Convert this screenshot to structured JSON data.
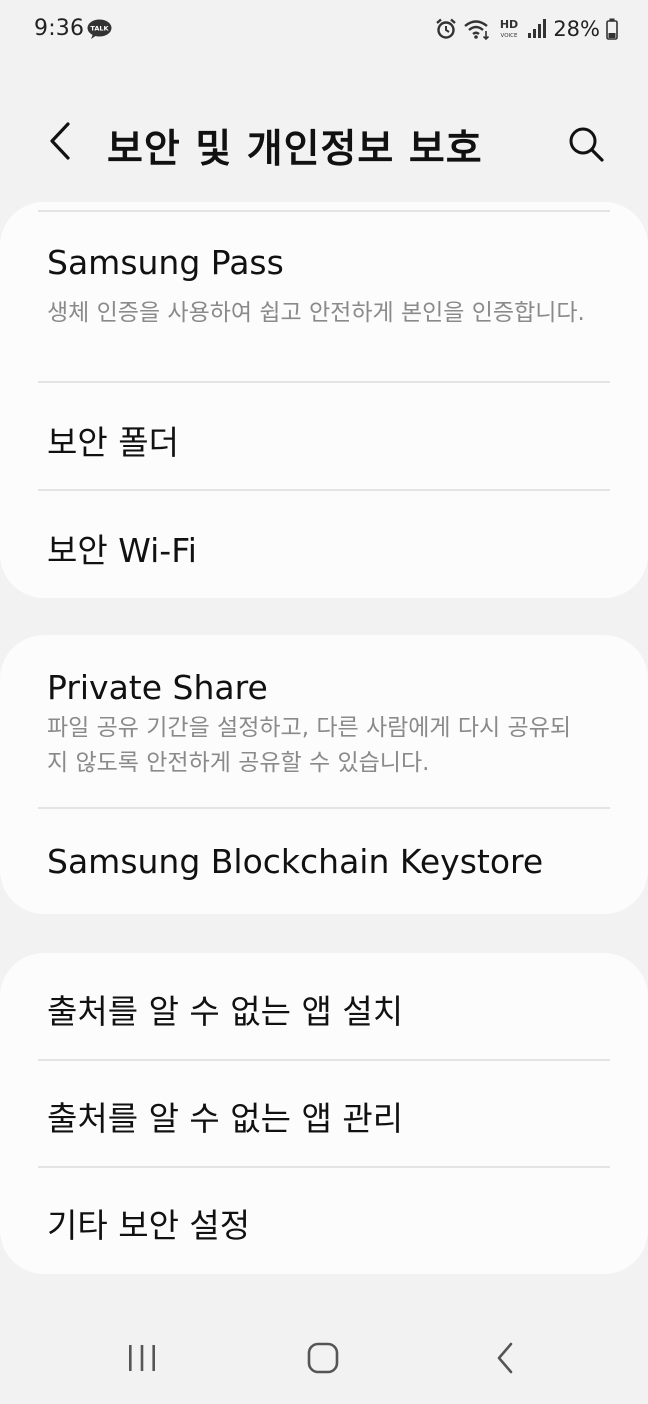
{
  "status_bar": {
    "time": "9:36",
    "talk_badge": "TALK",
    "hd_label": "HD",
    "voice_label": "VOICE",
    "battery_percent": "28%",
    "icons": [
      "kakaotalk-icon",
      "alarm-icon",
      "wifi-icon",
      "hd-voice-icon",
      "signal-icon",
      "battery-icon"
    ]
  },
  "header": {
    "title": "보안 및 개인정보 보호",
    "back_icon": "back-chevron-icon",
    "search_icon": "search-icon"
  },
  "sections": [
    {
      "items": [
        {
          "title": "Samsung Pass",
          "description": "생체 인증을 사용하여 쉽고 안전하게 본인을 인증합니다."
        },
        {
          "title": "보안 폴더"
        },
        {
          "title": "보안 Wi-Fi"
        }
      ]
    },
    {
      "items": [
        {
          "title": "Private Share",
          "description": "파일 공유 기간을 설정하고, 다른 사람에게 다시 공유되지 않도록 안전하게 공유할 수 있습니다."
        },
        {
          "title": "Samsung Blockchain Keystore"
        }
      ]
    },
    {
      "items": [
        {
          "title": "출처를 알 수 없는 앱 설치"
        },
        {
          "title": "출처를 알 수 없는 앱 관리"
        },
        {
          "title": "기타 보안 설정"
        }
      ]
    }
  ],
  "nav_bar": {
    "buttons": [
      "recent-apps-icon",
      "home-icon",
      "back-icon"
    ]
  },
  "colors": {
    "background": "#f2f2f2",
    "card": "#fcfcfc",
    "divider": "#e4e4e4",
    "title_text": "#111111",
    "secondary_text": "#8a8a8a"
  }
}
